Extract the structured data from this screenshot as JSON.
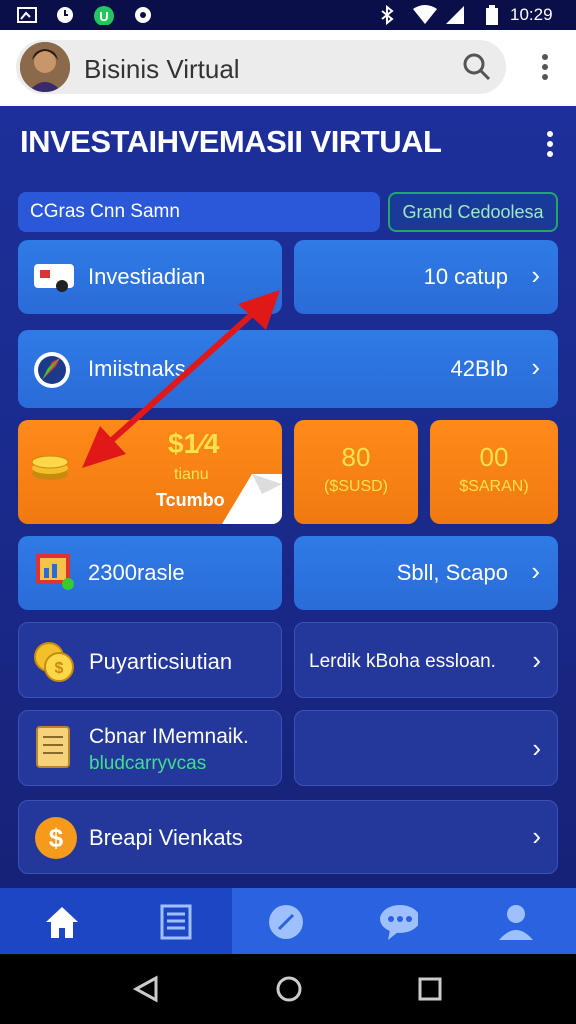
{
  "statusbar": {
    "time": "10:29"
  },
  "search": {
    "text": "Bisinis Virtual"
  },
  "main": {
    "title": "INVESTAIHVEMASII VIRTUAL"
  },
  "pills": {
    "left": "CGras Cnn Samn",
    "right": "Grand Cedoolesa"
  },
  "rows": {
    "r1_left": "Investiadian",
    "r1_right": "10 catup",
    "r2_left": "Imiistnaks",
    "r2_right": "42BIb",
    "r3_price": "$1⁄4",
    "r3_sub1": "tianu",
    "r3_sub2": "Tcumbo",
    "r3_mid_num": "80",
    "r3_mid_sub": "($SUSD)",
    "r3_right_num": "00",
    "r3_right_sub": "$SARAN)",
    "r4_left": "2300rasle",
    "r4_right": "Sbll, Scapo",
    "r5_left": "Puyarticsiutian",
    "r5_right": "Lerdik kBoha essloan.",
    "r6_left_1": "Cbnar IMemnaik.",
    "r6_left_2": "bludcarryvcas",
    "r7_left": "Breapi Vienkats"
  },
  "colors": {
    "accent_blue": "#2f7be6",
    "orange": "#f07a10",
    "green_text": "#3fe08a",
    "yellow_text": "#ffe14a"
  }
}
